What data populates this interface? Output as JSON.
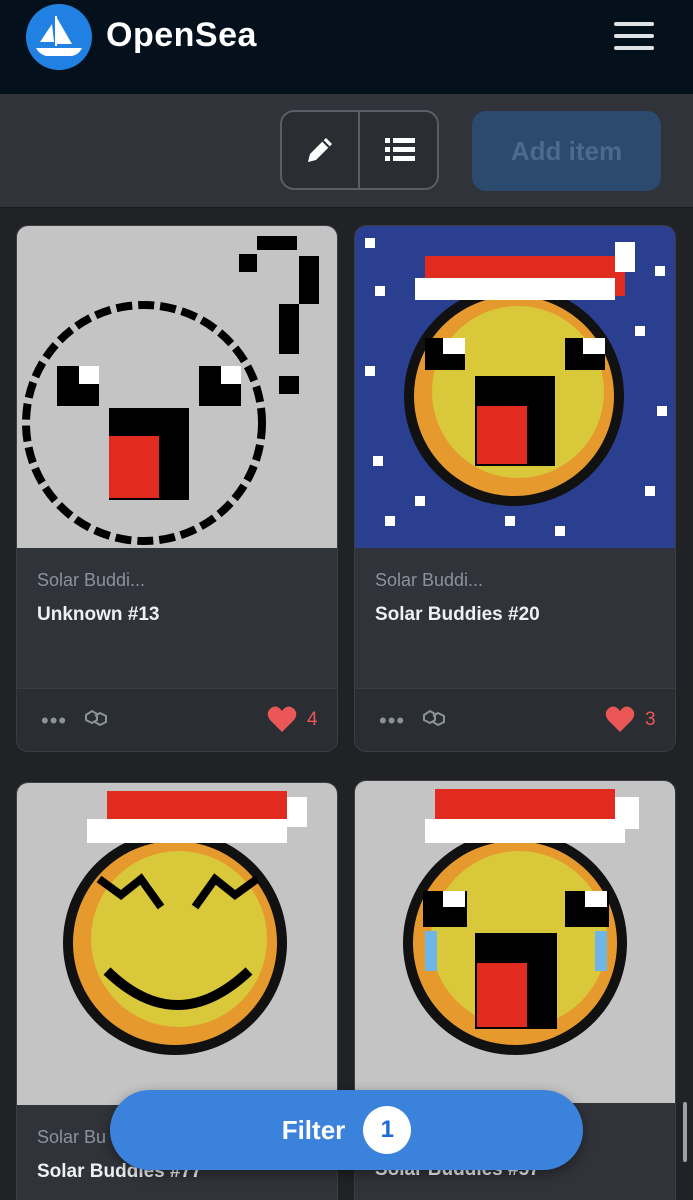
{
  "header": {
    "brand": "OpenSea",
    "logo_icon": "opensea-boat-icon",
    "menu_icon": "hamburger-menu-icon"
  },
  "toolbar": {
    "edit_icon": "pencil-icon",
    "list_icon": "list-view-icon",
    "add_item_label": "Add item"
  },
  "cards": [
    {
      "collection": "Solar Buddi...",
      "title": "Unknown #13",
      "likes": "4"
    },
    {
      "collection": "Solar Buddi...",
      "title": "Solar Buddies #20",
      "likes": "3"
    },
    {
      "collection": "Solar Bu",
      "title": "Solar Buddies #77",
      "likes": ""
    },
    {
      "collection": "",
      "title": "Solar Buddies #57",
      "likes": ""
    }
  ],
  "filter": {
    "label": "Filter",
    "count": "1"
  },
  "colors": {
    "header_bg": "#04111d",
    "accent": "#2081e2",
    "like": "#eb5757",
    "card_bg": "#303339"
  }
}
